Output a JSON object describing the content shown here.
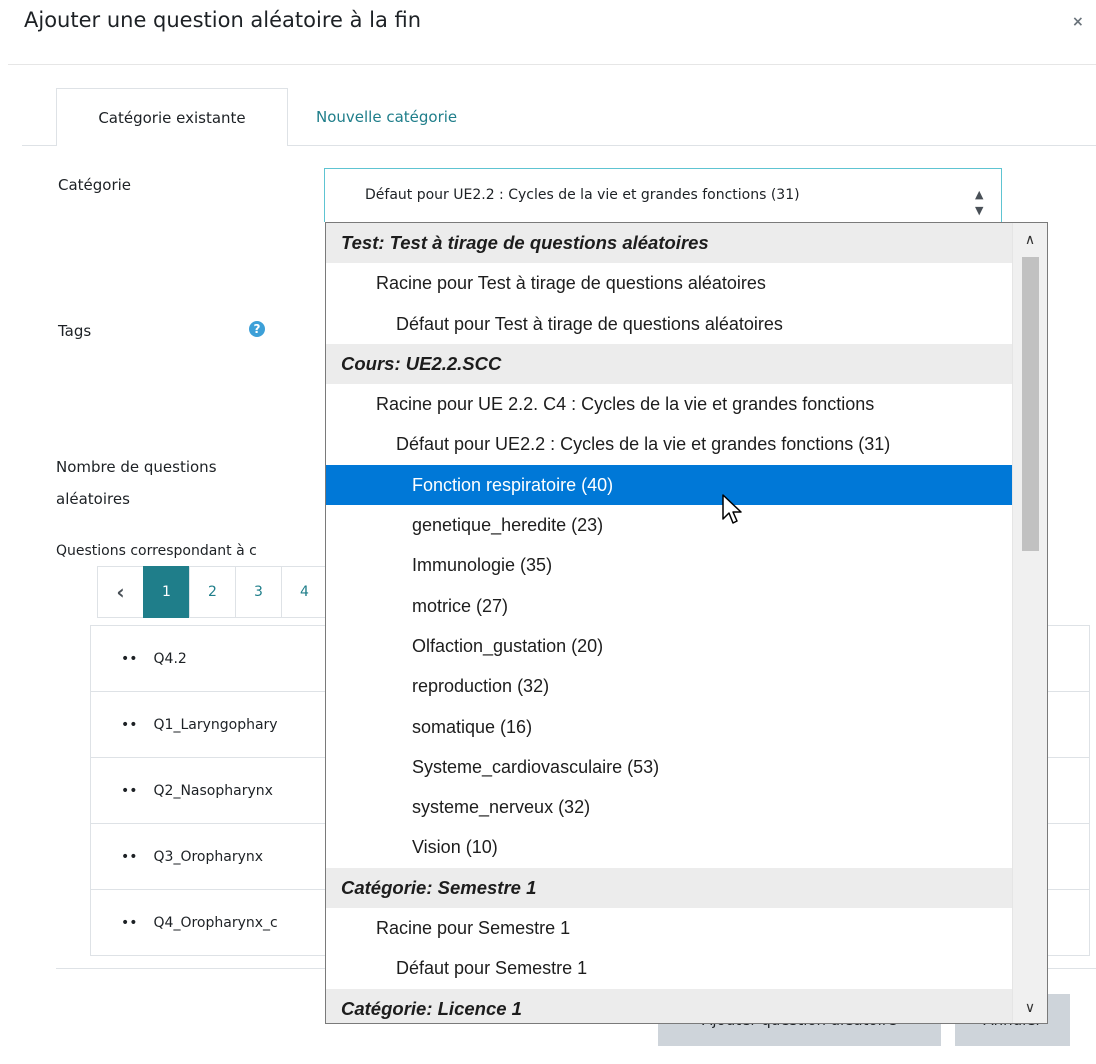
{
  "dialog": {
    "title": "Ajouter une question aléatoire à la fin",
    "close": "×"
  },
  "tabs": {
    "existing": "Catégorie existante",
    "new": "Nouvelle catégorie"
  },
  "form": {
    "category_label": "Catégorie",
    "category_value": "Défaut pour UE2.2 : Cycles de la vie et grandes fonctions (31)",
    "tags_label": "Tags",
    "count_label_line1": "Nombre de questions",
    "count_label_line2": "aléatoires",
    "matching_label": "Questions correspondant à c"
  },
  "pager": {
    "prev": "‹",
    "pages": [
      "1",
      "2",
      "3",
      "4"
    ],
    "active": "1"
  },
  "questions": [
    "Q4.2",
    "Q1_Laryngophary",
    "Q2_Nasopharynx",
    "Q3_Oropharynx",
    "Q4_Oropharynx_c"
  ],
  "buttons": {
    "add": "Ajouter question aléatoire",
    "cancel": "Annuler"
  },
  "dropdown": {
    "options": [
      {
        "text": "Test: Test à tirage de questions aléatoires",
        "kind": "group"
      },
      {
        "text": "Racine pour Test à tirage de questions aléatoires",
        "kind": "l1"
      },
      {
        "text": "Défaut pour Test à tirage de questions aléatoires",
        "kind": "l2"
      },
      {
        "text": "Cours: UE2.2.SCC",
        "kind": "group"
      },
      {
        "text": "Racine pour UE 2.2. C4 : Cycles de la vie et grandes fonctions",
        "kind": "l1"
      },
      {
        "text": "Défaut pour UE2.2 : Cycles de la vie et grandes fonctions (31)",
        "kind": "l2"
      },
      {
        "text": "Fonction respiratoire (40)",
        "kind": "l3",
        "selected": true
      },
      {
        "text": "genetique_heredite (23)",
        "kind": "l3"
      },
      {
        "text": "Immunologie (35)",
        "kind": "l3"
      },
      {
        "text": "motrice (27)",
        "kind": "l3"
      },
      {
        "text": "Olfaction_gustation (20)",
        "kind": "l3"
      },
      {
        "text": "reproduction (32)",
        "kind": "l3"
      },
      {
        "text": "somatique (16)",
        "kind": "l3"
      },
      {
        "text": "Systeme_cardiovasculaire (53)",
        "kind": "l3"
      },
      {
        "text": "systeme_nerveux (32)",
        "kind": "l3"
      },
      {
        "text": "Vision (10)",
        "kind": "l3"
      },
      {
        "text": "Catégorie: Semestre 1",
        "kind": "group"
      },
      {
        "text": "Racine pour Semestre 1",
        "kind": "l1"
      },
      {
        "text": "Défaut pour Semestre 1",
        "kind": "l2"
      },
      {
        "text": "Catégorie: Licence 1",
        "kind": "group"
      }
    ]
  },
  "icons": {
    "help": "question-circle-icon",
    "scroll_up": "chevron-up-icon",
    "scroll_down": "chevron-down-icon",
    "cursor": "mouse-pointer-icon"
  },
  "colors": {
    "accent": "#1f7e8a",
    "selected": "#0078d7",
    "help": "#3da0d8"
  }
}
